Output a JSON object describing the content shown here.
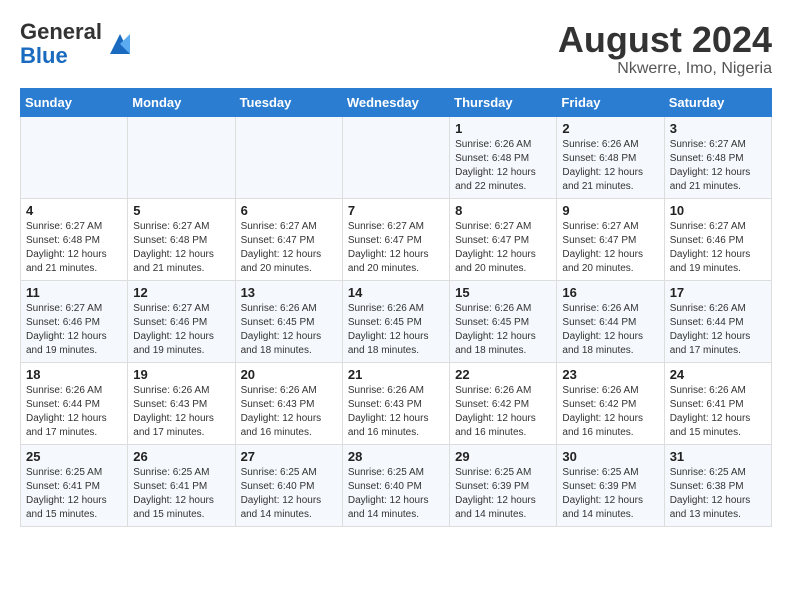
{
  "header": {
    "logo_general": "General",
    "logo_blue": "Blue",
    "month_year": "August 2024",
    "location": "Nkwerre, Imo, Nigeria"
  },
  "days_of_week": [
    "Sunday",
    "Monday",
    "Tuesday",
    "Wednesday",
    "Thursday",
    "Friday",
    "Saturday"
  ],
  "weeks": [
    [
      {
        "num": "",
        "info": ""
      },
      {
        "num": "",
        "info": ""
      },
      {
        "num": "",
        "info": ""
      },
      {
        "num": "",
        "info": ""
      },
      {
        "num": "1",
        "info": "Sunrise: 6:26 AM\nSunset: 6:48 PM\nDaylight: 12 hours\nand 22 minutes."
      },
      {
        "num": "2",
        "info": "Sunrise: 6:26 AM\nSunset: 6:48 PM\nDaylight: 12 hours\nand 21 minutes."
      },
      {
        "num": "3",
        "info": "Sunrise: 6:27 AM\nSunset: 6:48 PM\nDaylight: 12 hours\nand 21 minutes."
      }
    ],
    [
      {
        "num": "4",
        "info": "Sunrise: 6:27 AM\nSunset: 6:48 PM\nDaylight: 12 hours\nand 21 minutes."
      },
      {
        "num": "5",
        "info": "Sunrise: 6:27 AM\nSunset: 6:48 PM\nDaylight: 12 hours\nand 21 minutes."
      },
      {
        "num": "6",
        "info": "Sunrise: 6:27 AM\nSunset: 6:47 PM\nDaylight: 12 hours\nand 20 minutes."
      },
      {
        "num": "7",
        "info": "Sunrise: 6:27 AM\nSunset: 6:47 PM\nDaylight: 12 hours\nand 20 minutes."
      },
      {
        "num": "8",
        "info": "Sunrise: 6:27 AM\nSunset: 6:47 PM\nDaylight: 12 hours\nand 20 minutes."
      },
      {
        "num": "9",
        "info": "Sunrise: 6:27 AM\nSunset: 6:47 PM\nDaylight: 12 hours\nand 20 minutes."
      },
      {
        "num": "10",
        "info": "Sunrise: 6:27 AM\nSunset: 6:46 PM\nDaylight: 12 hours\nand 19 minutes."
      }
    ],
    [
      {
        "num": "11",
        "info": "Sunrise: 6:27 AM\nSunset: 6:46 PM\nDaylight: 12 hours\nand 19 minutes."
      },
      {
        "num": "12",
        "info": "Sunrise: 6:27 AM\nSunset: 6:46 PM\nDaylight: 12 hours\nand 19 minutes."
      },
      {
        "num": "13",
        "info": "Sunrise: 6:26 AM\nSunset: 6:45 PM\nDaylight: 12 hours\nand 18 minutes."
      },
      {
        "num": "14",
        "info": "Sunrise: 6:26 AM\nSunset: 6:45 PM\nDaylight: 12 hours\nand 18 minutes."
      },
      {
        "num": "15",
        "info": "Sunrise: 6:26 AM\nSunset: 6:45 PM\nDaylight: 12 hours\nand 18 minutes."
      },
      {
        "num": "16",
        "info": "Sunrise: 6:26 AM\nSunset: 6:44 PM\nDaylight: 12 hours\nand 18 minutes."
      },
      {
        "num": "17",
        "info": "Sunrise: 6:26 AM\nSunset: 6:44 PM\nDaylight: 12 hours\nand 17 minutes."
      }
    ],
    [
      {
        "num": "18",
        "info": "Sunrise: 6:26 AM\nSunset: 6:44 PM\nDaylight: 12 hours\nand 17 minutes."
      },
      {
        "num": "19",
        "info": "Sunrise: 6:26 AM\nSunset: 6:43 PM\nDaylight: 12 hours\nand 17 minutes."
      },
      {
        "num": "20",
        "info": "Sunrise: 6:26 AM\nSunset: 6:43 PM\nDaylight: 12 hours\nand 16 minutes."
      },
      {
        "num": "21",
        "info": "Sunrise: 6:26 AM\nSunset: 6:43 PM\nDaylight: 12 hours\nand 16 minutes."
      },
      {
        "num": "22",
        "info": "Sunrise: 6:26 AM\nSunset: 6:42 PM\nDaylight: 12 hours\nand 16 minutes."
      },
      {
        "num": "23",
        "info": "Sunrise: 6:26 AM\nSunset: 6:42 PM\nDaylight: 12 hours\nand 16 minutes."
      },
      {
        "num": "24",
        "info": "Sunrise: 6:26 AM\nSunset: 6:41 PM\nDaylight: 12 hours\nand 15 minutes."
      }
    ],
    [
      {
        "num": "25",
        "info": "Sunrise: 6:25 AM\nSunset: 6:41 PM\nDaylight: 12 hours\nand 15 minutes."
      },
      {
        "num": "26",
        "info": "Sunrise: 6:25 AM\nSunset: 6:41 PM\nDaylight: 12 hours\nand 15 minutes."
      },
      {
        "num": "27",
        "info": "Sunrise: 6:25 AM\nSunset: 6:40 PM\nDaylight: 12 hours\nand 14 minutes."
      },
      {
        "num": "28",
        "info": "Sunrise: 6:25 AM\nSunset: 6:40 PM\nDaylight: 12 hours\nand 14 minutes."
      },
      {
        "num": "29",
        "info": "Sunrise: 6:25 AM\nSunset: 6:39 PM\nDaylight: 12 hours\nand 14 minutes."
      },
      {
        "num": "30",
        "info": "Sunrise: 6:25 AM\nSunset: 6:39 PM\nDaylight: 12 hours\nand 14 minutes."
      },
      {
        "num": "31",
        "info": "Sunrise: 6:25 AM\nSunset: 6:38 PM\nDaylight: 12 hours\nand 13 minutes."
      }
    ]
  ]
}
